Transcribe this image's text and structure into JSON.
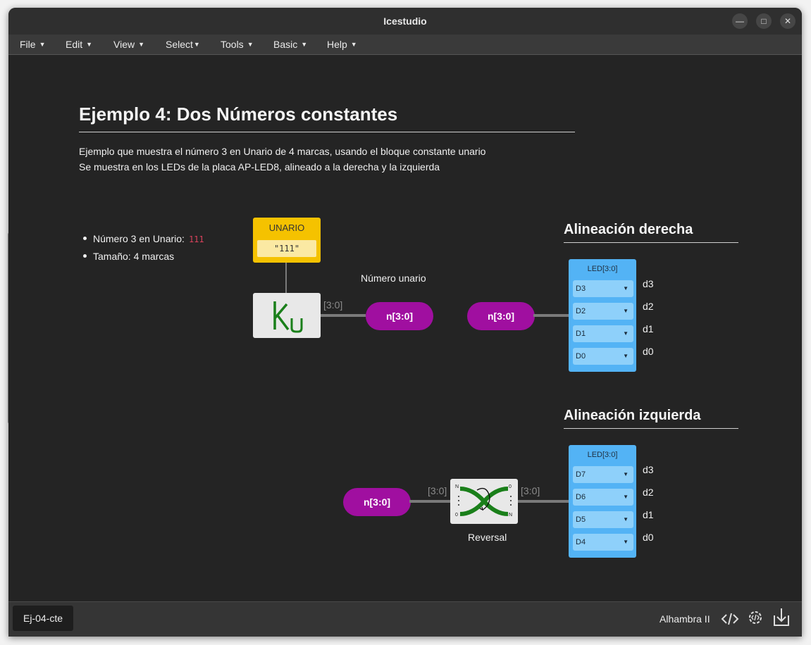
{
  "window": {
    "title": "Icestudio"
  },
  "window_controls": {
    "minimize": "—",
    "maximize": "□",
    "close": "✕"
  },
  "menu": [
    "File",
    "Edit",
    "View",
    "Select",
    "Tools",
    "Basic",
    "Help"
  ],
  "heading": "Ejemplo 4: Dos Números constantes",
  "description": [
    "Ejemplo que muestra el número 3 en Unario de 4 marcas, usando el bloque constante unario",
    "Se muestra en los LEDs de la placa AP-LED8, alineado a la derecha y la izquierda"
  ],
  "bullets": {
    "item1_label": "Número 3 en Unario:",
    "item1_value": "111",
    "item2": "Tamaño: 4 marcas"
  },
  "unario_block": {
    "label": "UNARIO",
    "value": "\"111\""
  },
  "ku_block": {
    "icon": "ku-icon"
  },
  "bus_width": "[3:0]",
  "numero_unario_label": "Número unario",
  "signal_label": "n[3:0]",
  "section_right": {
    "title": "Alineación derecha",
    "led_title": "LED[3:0]",
    "selects": [
      "D3",
      "D2",
      "D1",
      "D0"
    ],
    "pins": [
      "d3",
      "d2",
      "d1",
      "d0"
    ]
  },
  "section_left": {
    "title": "Alineación izquierda",
    "led_title": "LED[3:0]",
    "selects": [
      "D7",
      "D6",
      "D5",
      "D4"
    ],
    "pins": [
      "d3",
      "d2",
      "d1",
      "d0"
    ]
  },
  "reversal": {
    "label": "Reversal",
    "pins": [
      "N",
      "0",
      "0",
      "N"
    ]
  },
  "status": {
    "tab": "Ej-04-cte",
    "board": "Alhambra II"
  },
  "colors": {
    "unario": "#f5c200",
    "signal": "#a00fa0",
    "led": "#53b3f5",
    "canvas": "#242424",
    "green": "#1a7f1a"
  }
}
